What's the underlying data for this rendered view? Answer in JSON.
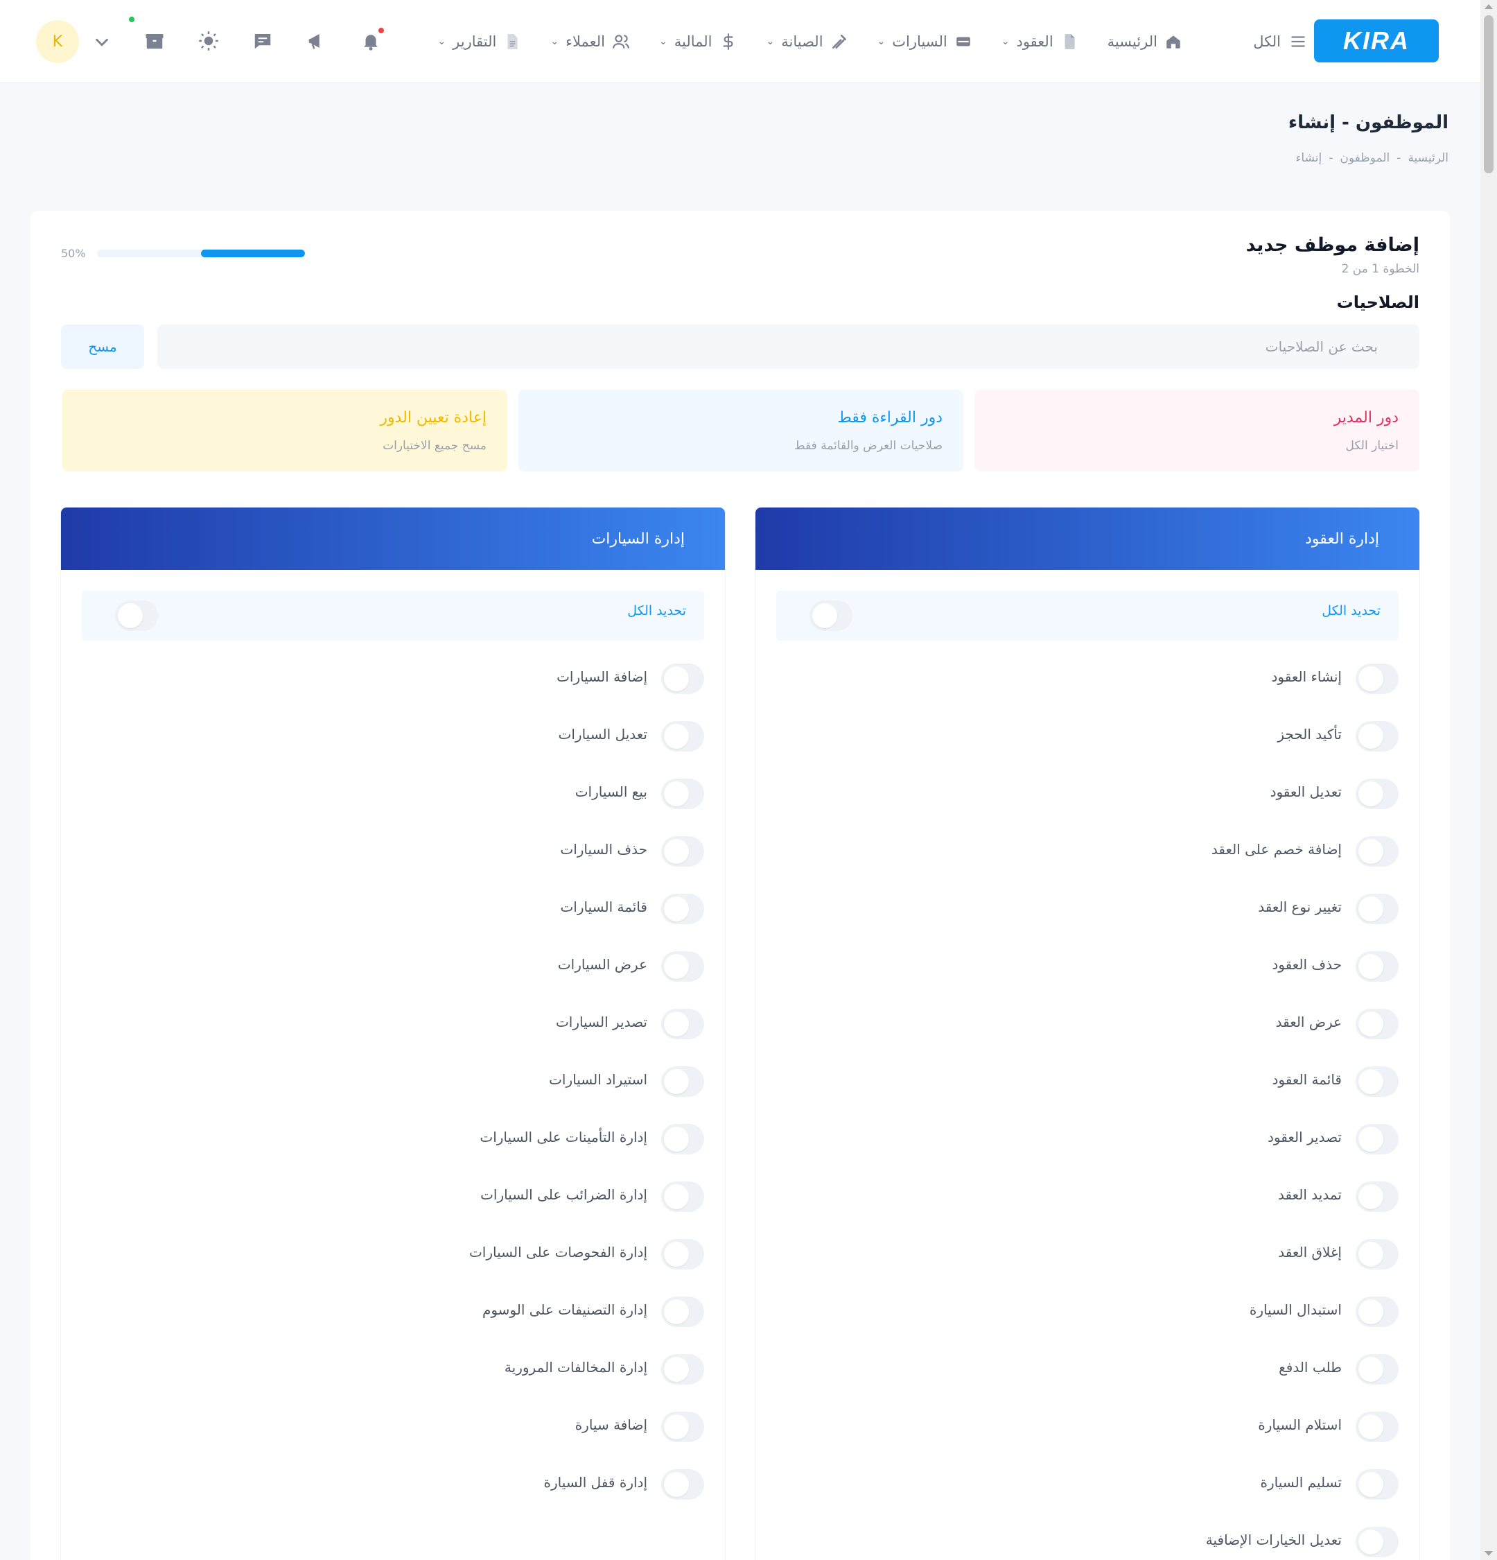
{
  "brand": {
    "logo_text": "KIRA",
    "accent": "#0f96f0"
  },
  "header": {
    "menu_label": "الكل",
    "nav": [
      {
        "label": "الرئيسية",
        "icon": "home-icon",
        "dropdown": false
      },
      {
        "label": "العقود",
        "icon": "document-icon",
        "dropdown": true
      },
      {
        "label": "السيارات",
        "icon": "car-icon",
        "dropdown": true
      },
      {
        "label": "الصيانة",
        "icon": "wrench-icon",
        "dropdown": true
      },
      {
        "label": "المالية",
        "icon": "dollar-icon",
        "dropdown": true
      },
      {
        "label": "العملاء",
        "icon": "users-icon",
        "dropdown": true
      },
      {
        "label": "التقارير",
        "icon": "report-icon",
        "dropdown": true
      }
    ],
    "user_initial": "K"
  },
  "page": {
    "title": "الموظفون - إنشاء",
    "breadcrumb": [
      "الرئيسية",
      "-",
      "الموظفون",
      "-",
      "إنشاء"
    ]
  },
  "form": {
    "title": "إضافة موظف جديد",
    "step_text": "الخطوة 1 من 2",
    "progress_label": "50%",
    "progress_value": 0.5,
    "section_title": "الصلاحيات",
    "search_placeholder": "بحث عن الصلاحيات",
    "clear_label": "مسح"
  },
  "roles": {
    "admin": {
      "title": "دور المدير",
      "subtitle": "اختيار الكل",
      "color": "#e0315f"
    },
    "read_only": {
      "title": "دور القراءة فقط",
      "subtitle": "صلاحيات العرض والقائمة فقط",
      "color": "#0f96f0"
    },
    "reset": {
      "title": "إعادة تعيين الدور",
      "subtitle": "مسح جميع الاختيارات",
      "color": "#f2b800"
    }
  },
  "panels": {
    "contracts": {
      "title": "إدارة العقود",
      "select_all": "تحديد الكل",
      "items": [
        "إنشاء العقود",
        "تأكيد الحجز",
        "تعديل العقود",
        "إضافة خصم على العقد",
        "تغيير نوع العقد",
        "حذف العقود",
        "عرض العقد",
        "قائمة العقود",
        "تصدير العقود",
        "تمديد العقد",
        "إغلاق العقد",
        "استبدال السيارة",
        "طلب الدفع",
        "استلام السيارة",
        "تسليم السيارة",
        "تعديل الخيارات الإضافية"
      ]
    },
    "cars": {
      "title": "إدارة السيارات",
      "select_all": "تحديد الكل",
      "items": [
        "إضافة السيارات",
        "تعديل السيارات",
        "بيع السيارات",
        "حذف السيارات",
        "قائمة السيارات",
        "عرض السيارات",
        "تصدير السيارات",
        "استيراد السيارات",
        "إدارة التأمينات على السيارات",
        "إدارة الضرائب على السيارات",
        "إدارة الفحوصات على السيارات",
        "إدارة التصنيفات على الوسوم",
        "إدارة المخالفات المرورية",
        "إضافة سيارة",
        "إدارة قفل السيارة"
      ]
    }
  }
}
